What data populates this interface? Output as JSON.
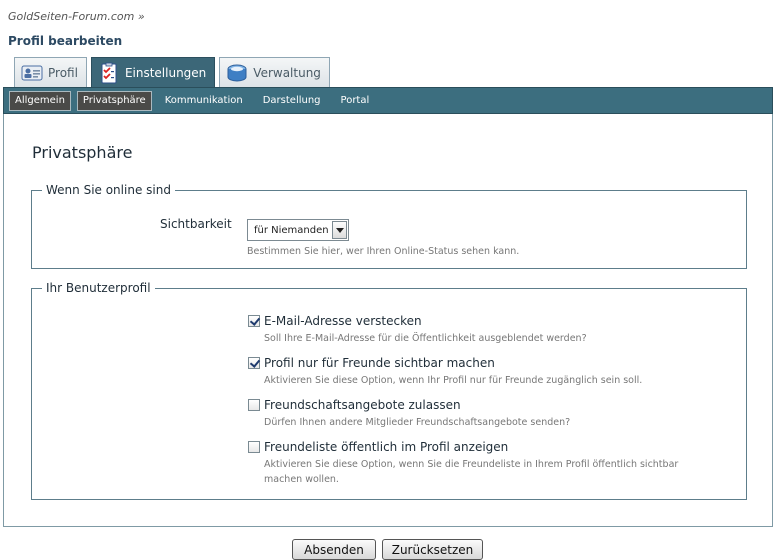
{
  "breadcrumb": "GoldSeiten-Forum.com »",
  "page_title": "Profil bearbeiten",
  "tabs": [
    {
      "label": "Profil",
      "icon": "profile-card-icon",
      "active": false
    },
    {
      "label": "Einstellungen",
      "icon": "settings-checklist-icon",
      "active": true
    },
    {
      "label": "Verwaltung",
      "icon": "management-box-icon",
      "active": false
    }
  ],
  "subnav": [
    {
      "label": "Allgemein"
    },
    {
      "label": "Privatsphäre",
      "active": true
    },
    {
      "label": "Kommunikation"
    },
    {
      "label": "Darstellung"
    },
    {
      "label": "Portal"
    }
  ],
  "section_title": "Privatsphäre",
  "online": {
    "legend": "Wenn Sie online sind",
    "visibility_label": "Sichtbarkeit",
    "visibility_value": "für Niemanden",
    "visibility_hint": "Bestimmen Sie hier, wer Ihren Online-Status sehen kann."
  },
  "profile": {
    "legend": "Ihr Benutzerprofil",
    "options": [
      {
        "label": "E-Mail-Adresse verstecken",
        "checked": true,
        "hint": "Soll Ihre E-Mail-Adresse für die Öffentlichkeit ausgeblendet werden?"
      },
      {
        "label": "Profil nur für Freunde sichtbar machen",
        "checked": true,
        "hint": "Aktivieren Sie diese Option, wenn Ihr Profil nur für Freunde zugänglich sein soll."
      },
      {
        "label": "Freundschaftsangebote zulassen",
        "checked": false,
        "hint": "Dürfen Ihnen andere Mitglieder Freundschaftsangebote senden?"
      },
      {
        "label": "Freundeliste öffentlich im Profil anzeigen",
        "checked": false,
        "hint": "Aktivieren Sie diese Option, wenn Sie die Freundeliste in Ihrem Profil öffentlich sichtbar machen wollen."
      }
    ]
  },
  "buttons": {
    "submit": "Absenden",
    "reset": "Zurücksetzen"
  },
  "colors": {
    "subnav_bg": "#3c6e7f",
    "active_tab_bg": "#3c6778",
    "fieldset_border": "#5d7d8b",
    "title_color": "#2d4a63"
  }
}
